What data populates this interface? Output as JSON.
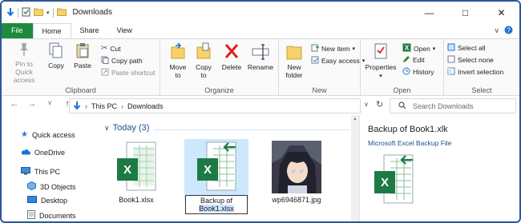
{
  "window": {
    "title": "Downloads"
  },
  "tabs": {
    "file": "File",
    "home": "Home",
    "share": "Share",
    "view": "View"
  },
  "ribbon": {
    "clipboard": {
      "pin_label": "Pin to Quick\naccess",
      "pin_line1": "Pin to Quick",
      "pin_line2": "access",
      "copy": "Copy",
      "paste": "Paste",
      "cut": "Cut",
      "copy_path": "Copy path",
      "paste_shortcut": "Paste shortcut",
      "group": "Clipboard"
    },
    "organize": {
      "move_line1": "Move",
      "move_line2": "to",
      "copy_line1": "Copy",
      "copy_line2": "to",
      "delete": "Delete",
      "rename": "Rename",
      "group": "Organize"
    },
    "new": {
      "folder_line1": "New",
      "folder_line2": "folder",
      "new_item": "New item",
      "easy_access": "Easy access",
      "group": "New"
    },
    "open": {
      "properties": "Properties",
      "open": "Open",
      "edit": "Edit",
      "history": "History",
      "group": "Open"
    },
    "select": {
      "select_all": "Select all",
      "select_none": "Select none",
      "invert": "Invert selection",
      "group": "Select"
    }
  },
  "address": {
    "path_root": "This PC",
    "path_leaf": "Downloads",
    "search_placeholder": "Search Downloads"
  },
  "sidebar": {
    "items": [
      {
        "label": "Quick access"
      },
      {
        "label": "OneDrive"
      },
      {
        "label": "This PC"
      },
      {
        "label": "3D Objects"
      },
      {
        "label": "Desktop"
      },
      {
        "label": "Documents"
      }
    ]
  },
  "main": {
    "group_heading": "Today (3)",
    "files": [
      {
        "label": "Book1.xlsx"
      },
      {
        "label_line1": "Backup of",
        "label_line2": "Book1.xlsx"
      },
      {
        "label": "wp6946871.jpg"
      }
    ]
  },
  "preview": {
    "title": "Backup of Book1.xlk",
    "subtitle": "Microsoft Excel Backup File"
  },
  "colors": {
    "accent": "#1e8a3e",
    "selection": "#cce8ff",
    "frame": "#2b5797"
  }
}
